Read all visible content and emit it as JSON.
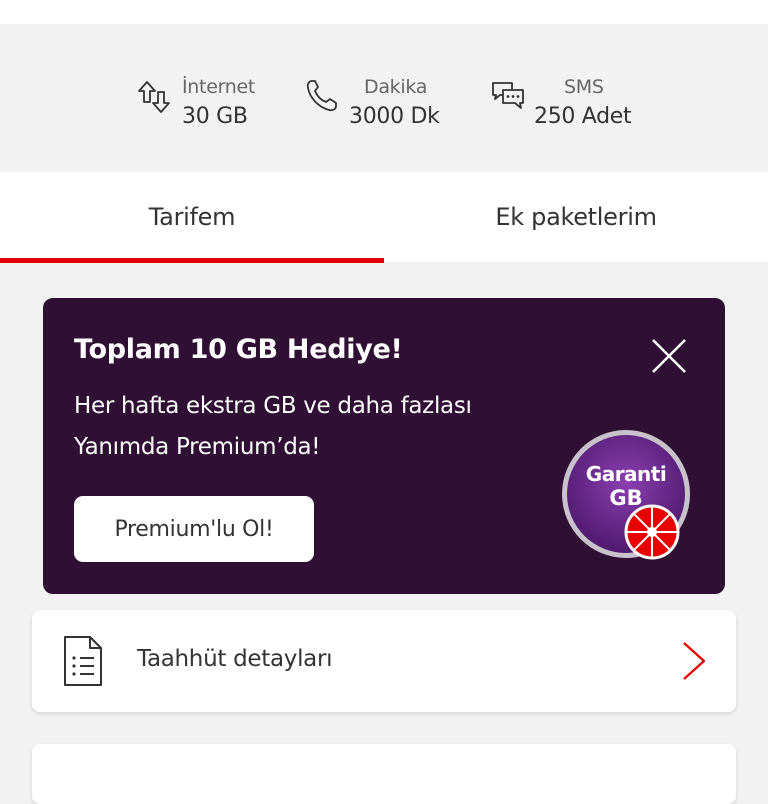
{
  "usage": {
    "internet": {
      "label": "İnternet",
      "value": "30 GB",
      "icon": "arrows-updown-icon"
    },
    "minutes": {
      "label": "Dakika",
      "value": "3000 Dk",
      "icon": "phone-icon"
    },
    "sms": {
      "label": "SMS",
      "value": "250 Adet",
      "icon": "chat-bubbles-icon"
    }
  },
  "tabs": [
    {
      "label": "Tarifem",
      "active": true
    },
    {
      "label": "Ek paketlerim",
      "active": false
    }
  ],
  "colors": {
    "accent": "#e60000",
    "promo_bg": "#2f0f33",
    "badge": "#6a2c8c"
  },
  "promo": {
    "title": "Toplam 10 GB Hediye!",
    "line1": "Her hafta ekstra GB ve daha fazlası",
    "line2": "Yanımda Premium’da!",
    "button_label": "Premium'lu Ol!",
    "badge_line1": "Garanti",
    "badge_line2": "GB",
    "close_icon": "close-icon"
  },
  "commitment": {
    "label": "Taahhüt detayları",
    "icon": "document-icon",
    "chevron": "chevron-right-icon"
  }
}
